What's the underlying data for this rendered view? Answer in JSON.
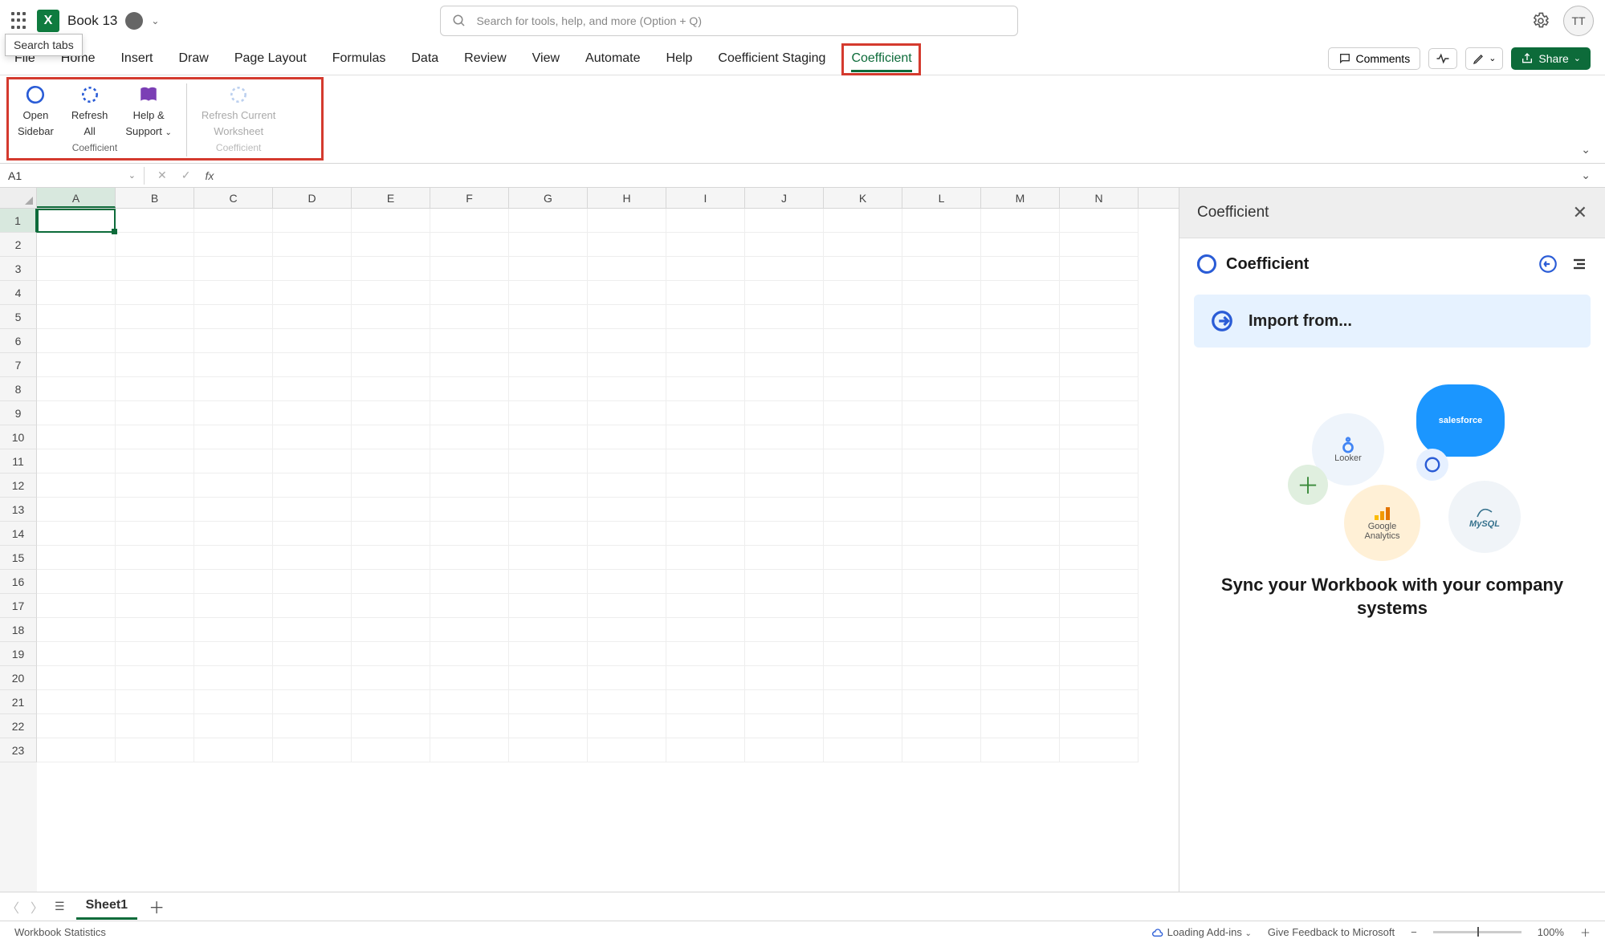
{
  "titlebar": {
    "doc_title": "Book 13",
    "search_placeholder": "Search for tools, help, and more (Option + Q)",
    "avatar_initials": "TT",
    "tooltip": "Search tabs"
  },
  "tabs": [
    "File",
    "Home",
    "Insert",
    "Draw",
    "Page Layout",
    "Formulas",
    "Data",
    "Review",
    "View",
    "Automate",
    "Help",
    "Coefficient Staging",
    "Coefficient"
  ],
  "active_tab": "Coefficient",
  "actions": {
    "comments": "Comments",
    "share": "Share"
  },
  "ribbon": {
    "group1_label": "Coefficient",
    "group2_label": "Coefficient",
    "btn_open_l1": "Open",
    "btn_open_l2": "Sidebar",
    "btn_refresh_l1": "Refresh",
    "btn_refresh_l2": "All",
    "btn_help_l1": "Help &",
    "btn_help_l2": "Support",
    "btn_rw_l1": "Refresh Current",
    "btn_rw_l2": "Worksheet"
  },
  "formula": {
    "name_box": "A1"
  },
  "columns": [
    "A",
    "B",
    "C",
    "D",
    "E",
    "F",
    "G",
    "H",
    "I",
    "J",
    "K",
    "L",
    "M",
    "N"
  ],
  "rows": [
    "1",
    "2",
    "3",
    "4",
    "5",
    "6",
    "7",
    "8",
    "9",
    "10",
    "11",
    "12",
    "13",
    "14",
    "15",
    "16",
    "17",
    "18",
    "19",
    "20",
    "21",
    "22",
    "23"
  ],
  "panel": {
    "title": "Coefficient",
    "brand": "Coefficient",
    "import_label": "Import from...",
    "bubble_looker": "Looker",
    "bubble_salesforce": "salesforce",
    "bubble_ga_l1": "Google",
    "bubble_ga_l2": "Analytics",
    "bubble_mysql": "MySQL",
    "tagline": "Sync your Workbook with your company systems"
  },
  "sheet_tab": "Sheet1",
  "status": {
    "stats": "Workbook Statistics",
    "loading": "Loading Add-ins",
    "feedback": "Give Feedback to Microsoft",
    "zoom": "100%"
  }
}
